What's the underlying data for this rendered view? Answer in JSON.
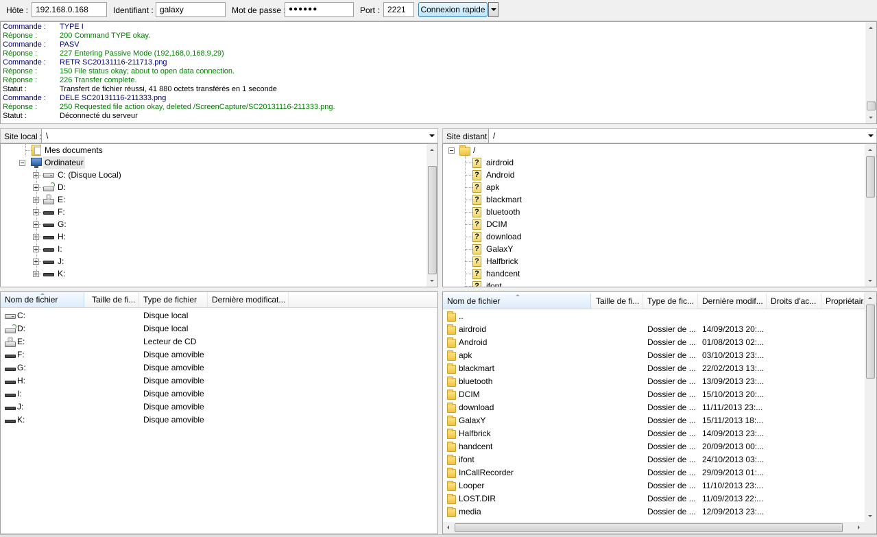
{
  "quickconnect": {
    "host_label": "Hôte :",
    "host_value": "192.168.0.168",
    "user_label": "Identifiant :",
    "user_value": "galaxy",
    "pass_label": "Mot de passe :",
    "pass_value": "●●●●●●",
    "port_label": "Port :",
    "port_value": "2221",
    "connect_label": "Connexion rapide"
  },
  "log": [
    {
      "kind": "Commande :",
      "text": "TYPE I",
      "type": "cmd"
    },
    {
      "kind": "Réponse :",
      "text": "200 Command TYPE okay.",
      "type": "resp"
    },
    {
      "kind": "Commande :",
      "text": "PASV",
      "type": "cmd"
    },
    {
      "kind": "Réponse :",
      "text": "227 Entering Passive Mode (192,168,0,168,9,29)",
      "type": "resp"
    },
    {
      "kind": "Commande :",
      "text": "RETR SC20131116-211713.png",
      "type": "cmd"
    },
    {
      "kind": "Réponse :",
      "text": "150 File status okay; about to open data connection.",
      "type": "resp"
    },
    {
      "kind": "Réponse :",
      "text": "226 Transfer complete.",
      "type": "resp"
    },
    {
      "kind": "Statut :",
      "text": "Transfert de fichier réussi, 41 880 octets transférés en 1 seconde",
      "type": "stat"
    },
    {
      "kind": "Commande :",
      "text": "DELE SC20131116-211333.png",
      "type": "cmd"
    },
    {
      "kind": "Réponse :",
      "text": "250 Requested file action okay, deleted /ScreenCapture/SC20131116-211333.png.",
      "type": "resp"
    },
    {
      "kind": "Statut :",
      "text": "Déconnecté du serveur",
      "type": "stat"
    }
  ],
  "local": {
    "site_label": "Site local :",
    "path": "\\",
    "tree": {
      "documents": "Mes documents",
      "computer": "Ordinateur",
      "drives": [
        {
          "label": "C: (Disque Local)",
          "icon": "hard-drive-icon"
        },
        {
          "label": "D:",
          "icon": "network-drive-icon"
        },
        {
          "label": "E:",
          "icon": "cd-drive-icon"
        },
        {
          "label": "F:",
          "icon": "removable-drive-icon"
        },
        {
          "label": "G:",
          "icon": "removable-drive-icon"
        },
        {
          "label": "H:",
          "icon": "removable-drive-icon"
        },
        {
          "label": "I:",
          "icon": "removable-drive-icon"
        },
        {
          "label": "J:",
          "icon": "removable-drive-icon"
        },
        {
          "label": "K:",
          "icon": "removable-drive-icon"
        }
      ]
    },
    "columns": [
      "Nom de fichier",
      "Taille de fi...",
      "Type de fichier",
      "Dernière modificat..."
    ],
    "files": [
      {
        "name": "C:",
        "type": "Disque local",
        "icon": "hard-drive-icon"
      },
      {
        "name": "D:",
        "type": "Disque local",
        "icon": "network-drive-icon"
      },
      {
        "name": "E:",
        "type": "Lecteur de CD",
        "icon": "cd-drive-icon"
      },
      {
        "name": "F:",
        "type": "Disque amovible",
        "icon": "removable-drive-icon"
      },
      {
        "name": "G:",
        "type": "Disque amovible",
        "icon": "removable-drive-icon"
      },
      {
        "name": "H:",
        "type": "Disque amovible",
        "icon": "removable-drive-icon"
      },
      {
        "name": "I:",
        "type": "Disque amovible",
        "icon": "removable-drive-icon"
      },
      {
        "name": "J:",
        "type": "Disque amovible",
        "icon": "removable-drive-icon"
      },
      {
        "name": "K:",
        "type": "Disque amovible",
        "icon": "removable-drive-icon"
      }
    ]
  },
  "remote": {
    "site_label": "Site distant :",
    "path": "/",
    "tree": {
      "root": "/",
      "items": [
        "airdroid",
        "Android",
        "apk",
        "blackmart",
        "bluetooth",
        "DCIM",
        "download",
        "GalaxY",
        "Halfbrick",
        "handcent",
        "ifont"
      ]
    },
    "columns": [
      "Nom de fichier",
      "Taille de fi...",
      "Type de fic...",
      "Dernière modif...",
      "Droits d'ac...",
      "Propriétair..."
    ],
    "files": [
      {
        "name": "..",
        "type": "",
        "date": ""
      },
      {
        "name": "airdroid",
        "type": "Dossier de ...",
        "date": "14/09/2013 20:..."
      },
      {
        "name": "Android",
        "type": "Dossier de ...",
        "date": "01/08/2013 02:..."
      },
      {
        "name": "apk",
        "type": "Dossier de ...",
        "date": "03/10/2013 23:..."
      },
      {
        "name": "blackmart",
        "type": "Dossier de ...",
        "date": "22/02/2013 13:..."
      },
      {
        "name": "bluetooth",
        "type": "Dossier de ...",
        "date": "13/09/2013 23:..."
      },
      {
        "name": "DCIM",
        "type": "Dossier de ...",
        "date": "15/10/2013 20:..."
      },
      {
        "name": "download",
        "type": "Dossier de ...",
        "date": "11/11/2013 23:..."
      },
      {
        "name": "GalaxY",
        "type": "Dossier de ...",
        "date": "15/11/2013 18:..."
      },
      {
        "name": "Halfbrick",
        "type": "Dossier de ...",
        "date": "14/09/2013 23:..."
      },
      {
        "name": "handcent",
        "type": "Dossier de ...",
        "date": "20/09/2013 00:..."
      },
      {
        "name": "ifont",
        "type": "Dossier de ...",
        "date": "24/10/2013 03:..."
      },
      {
        "name": "InCallRecorder",
        "type": "Dossier de ...",
        "date": "29/09/2013 01:..."
      },
      {
        "name": "Looper",
        "type": "Dossier de ...",
        "date": "11/10/2013 23:..."
      },
      {
        "name": "LOST.DIR",
        "type": "Dossier de ...",
        "date": "11/09/2013 22:..."
      },
      {
        "name": "media",
        "type": "Dossier de ...",
        "date": "12/09/2013 23:..."
      }
    ]
  }
}
